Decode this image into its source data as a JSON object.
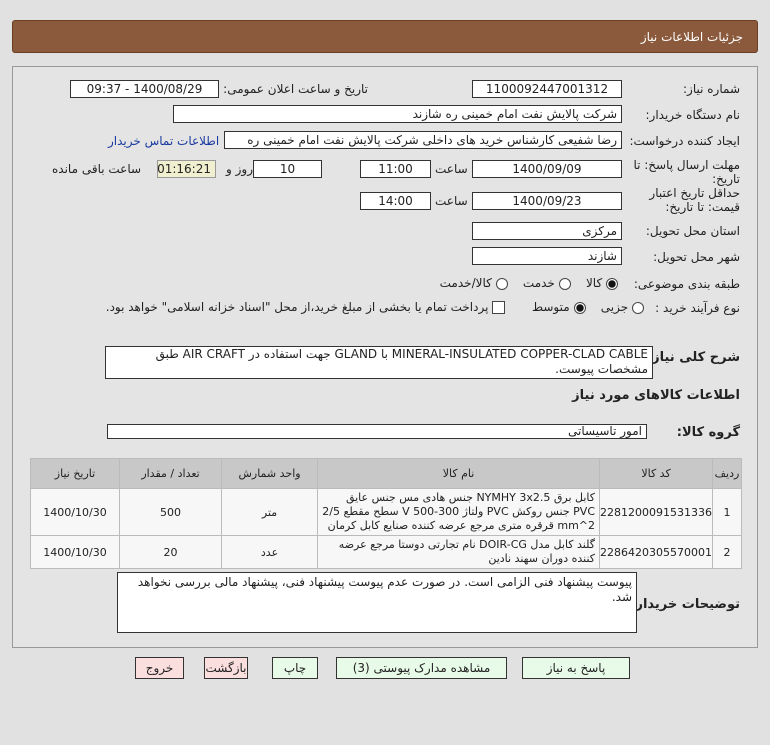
{
  "header": {
    "title": "جزئیات اطلاعات نیاز"
  },
  "form": {
    "need_number_label": "شماره نیاز:",
    "need_number": "1100092447001312",
    "announce_label": "تاریخ و ساعت اعلان عمومی:",
    "announce_value": "1400/08/29 - 09:37",
    "buyer_org_label": "نام دستگاه خریدار:",
    "buyer_org": "شرکت پالایش نفت امام خمینی  ره  شازند",
    "creator_label": "ایجاد کننده درخواست:",
    "creator": "رضا  شفیعی  کارشناس خرید های داخلی  شرکت پالایش نفت امام خمینی  ره",
    "contact_link": "اطلاعات تماس خریدار",
    "deadline_label": "مهلت ارسال پاسخ: تا تاریخ:",
    "deadline_date": "1400/09/09",
    "time_label": "ساعت",
    "deadline_time": "11:00",
    "days": "10",
    "days_label": "روز و",
    "remaining": "01:16:21",
    "remaining_label": "ساعت باقی مانده",
    "validity_label": "حداقل تاریخ اعتبار قیمت: تا تاریخ:",
    "validity_date": "1400/09/23",
    "validity_time": "14:00",
    "province_label": "استان محل تحویل:",
    "province": "مرکزی",
    "city_label": "شهر محل تحویل:",
    "city": "شازند",
    "category_label": "طبقه بندی موضوعی:",
    "category_options": [
      "کالا",
      "خدمت",
      "کالا/خدمت"
    ],
    "category_selected": "کالا",
    "process_label": "نوع فرآیند خرید :",
    "process_options": [
      "جزیی",
      "متوسط"
    ],
    "process_selected": "متوسط",
    "payment_note": "پرداخت تمام یا بخشی از مبلغ خرید،از محل \"اسناد خزانه اسلامی\" خواهد بود.",
    "description_label": "شرح کلی نیاز:",
    "description": "MINERAL-INSULATED COPPER-CLAD CABLE با GLAND جهت استفاده در AIR CRAFT طبق مشخصات پیوست.",
    "goods_info_title": "اطلاعات کالاهای مورد نیاز",
    "group_label": "گروه کالا:",
    "group": "امور تاسیساتی"
  },
  "table": {
    "headers": [
      "ردیف",
      "کد کالا",
      "نام کالا",
      "واحد شمارش",
      "تعداد / مقدار",
      "تاریخ نیاز"
    ],
    "rows": [
      [
        "1",
        "2281200091531336",
        "کابل برق NYMHY 3x2.5 جنس هادی مس جنس عایق PVC جنس روکش PVC ولتاژ 300-500 V سطح مقطع 2/5 mm^2 قرقره متری مرجع عرضه کننده صنایع کابل کرمان",
        "متر",
        "500",
        "1400/10/30"
      ],
      [
        "2",
        "2286420305570001",
        "گلند کابل مدل DOIR-CG نام تجارتی دوستا مرجع عرضه کننده دوران سهند نادین",
        "عدد",
        "20",
        "1400/10/30"
      ]
    ]
  },
  "notes": {
    "label": "توضیحات خریدار:",
    "text": "پیوست پیشنهاد فنی الزامی است. در صورت عدم پیوست پیشنهاد فنی، پیشنهاد مالی بررسی نخواهد شد."
  },
  "buttons": {
    "reply": "پاسخ به نیاز",
    "attachments": "مشاهده مدارک پیوستی (3)",
    "print": "چاپ",
    "back": "بازگشت",
    "exit": "خروج"
  }
}
